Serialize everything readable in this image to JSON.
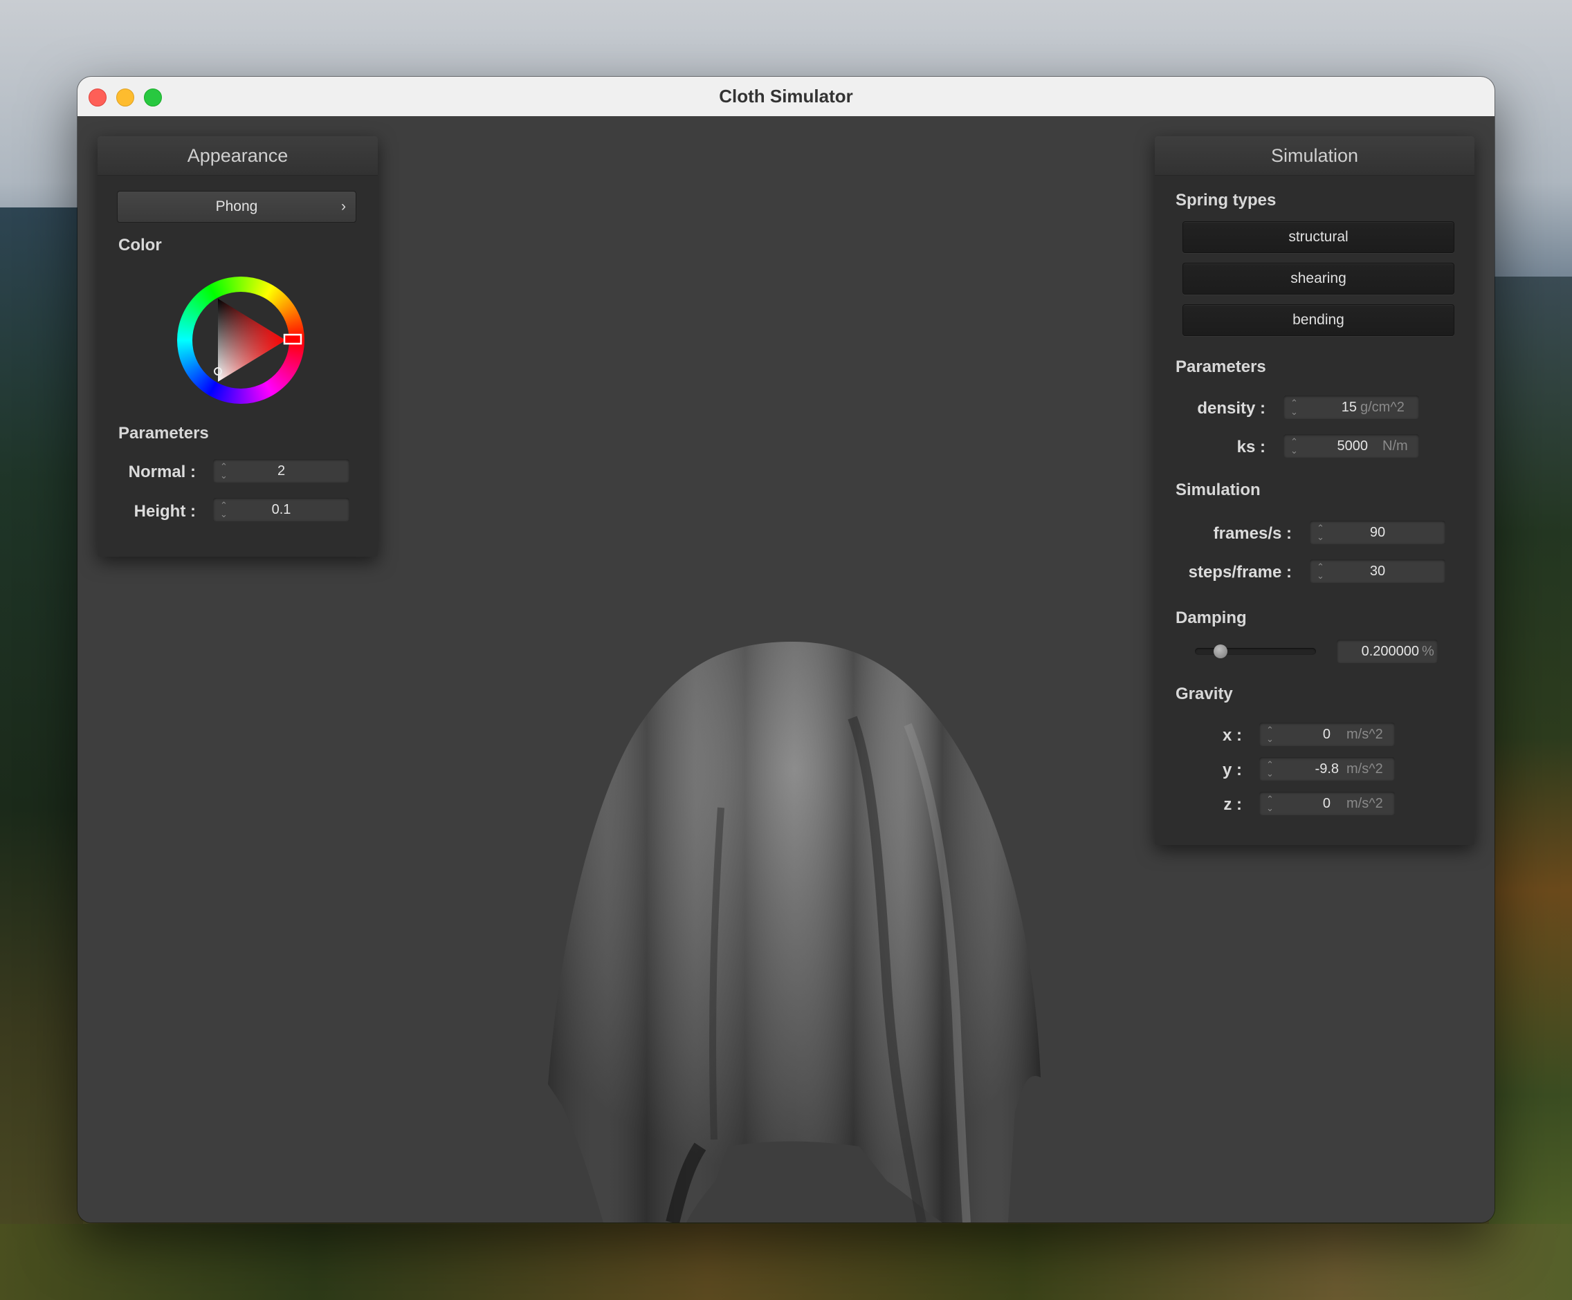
{
  "window": {
    "title": "Cloth Simulator"
  },
  "appearance": {
    "title": "Appearance",
    "shader": "Phong",
    "color_label": "Color",
    "color_value": "#ff0000",
    "params_label": "Parameters",
    "normal_label": "Normal :",
    "normal_value": "2",
    "height_label": "Height :",
    "height_value": "0.1"
  },
  "simulation_panel": {
    "title": "Simulation",
    "spring_types_label": "Spring types",
    "spring_types": [
      "structural",
      "shearing",
      "bending"
    ],
    "params_label": "Parameters",
    "density_label": "density :",
    "density_value": "15",
    "density_unit": "g/cm^2",
    "ks_label": "ks :",
    "ks_value": "5000",
    "ks_unit": "N/m",
    "sim_label": "Simulation",
    "fps_label": "frames/s :",
    "fps_value": "90",
    "steps_label": "steps/frame :",
    "steps_value": "30",
    "damping_label": "Damping",
    "damping_value": "0.200000",
    "damping_unit": "%",
    "damping_level": 0.2,
    "gravity_label": "Gravity",
    "x_label": "x :",
    "x_value": "0",
    "y_label": "y :",
    "y_value": "-9.8",
    "z_label": "z :",
    "z_value": "0",
    "gravity_unit": "m/s^2"
  }
}
